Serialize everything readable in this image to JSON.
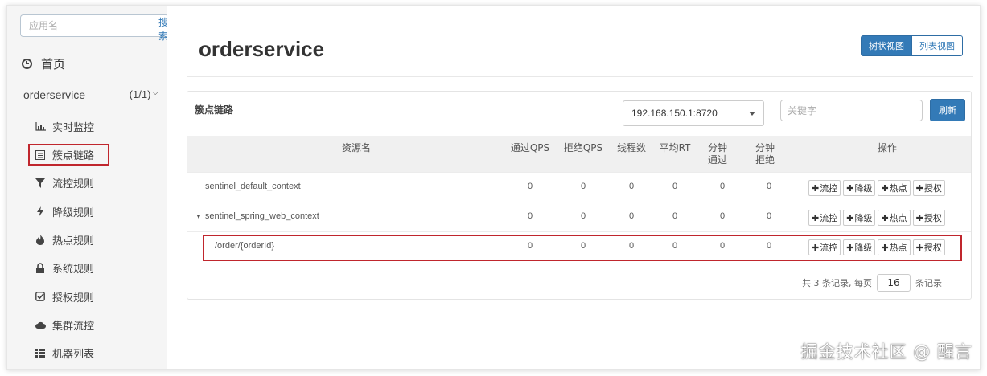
{
  "search": {
    "placeholder": "应用名",
    "button": "搜索"
  },
  "sidebar": {
    "home": "首页",
    "app": {
      "name": "orderservice",
      "count": "(1/1)"
    },
    "items": [
      {
        "label": "实时监控",
        "icon": "bar-chart-icon"
      },
      {
        "label": "簇点链路",
        "icon": "list-alt-icon"
      },
      {
        "label": "流控规则",
        "icon": "filter-icon"
      },
      {
        "label": "降级规则",
        "icon": "flash-icon"
      },
      {
        "label": "热点规则",
        "icon": "fire-icon"
      },
      {
        "label": "系统规则",
        "icon": "lock-icon"
      },
      {
        "label": "授权规则",
        "icon": "check-icon"
      },
      {
        "label": "集群流控",
        "icon": "cloud-icon"
      },
      {
        "label": "机器列表",
        "icon": "th-list-icon"
      }
    ]
  },
  "header": {
    "title": "orderservice",
    "tree_view": "树状视图",
    "list_view": "列表视图"
  },
  "panel": {
    "title": "簇点链路",
    "machine": "192.168.150.1:8720",
    "keyword_placeholder": "关键字",
    "refresh": "刷新"
  },
  "table": {
    "headers": [
      "资源名",
      "通过QPS",
      "拒绝QPS",
      "线程数",
      "平均RT",
      "分钟通过",
      "分钟拒绝",
      "操作"
    ],
    "rows": [
      {
        "name": "sentinel_default_context",
        "values": [
          "0",
          "0",
          "0",
          "0",
          "0",
          "0"
        ]
      },
      {
        "name": "sentinel_spring_web_context",
        "values": [
          "0",
          "0",
          "0",
          "0",
          "0",
          "0"
        ]
      },
      {
        "name": "/order/{orderId}",
        "values": [
          "0",
          "0",
          "0",
          "0",
          "0",
          "0"
        ]
      }
    ],
    "ops": [
      "流控",
      "降级",
      "热点",
      "授权"
    ]
  },
  "footer": {
    "total": "共 3 条记录, 每页",
    "page_size": "16",
    "unit": "条记录"
  },
  "watermark": "掘金技术社区 @ 醒言",
  "colors": {
    "primary": "#337ab7",
    "highlight": "#c0262d"
  }
}
